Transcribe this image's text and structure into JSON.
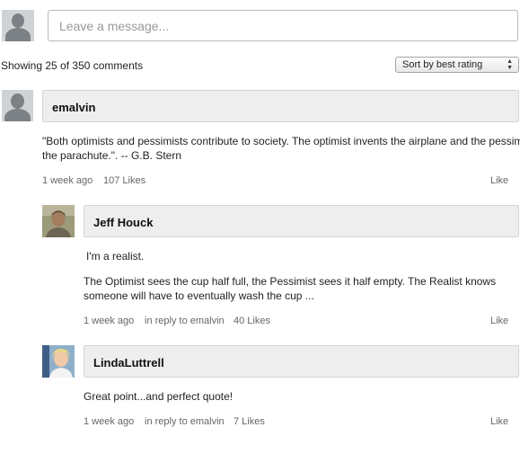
{
  "composer": {
    "placeholder": "Leave a message..."
  },
  "summary": {
    "showing_text": "Showing 25 of 350 comments",
    "sort_label": "Sort by best rating"
  },
  "comments": [
    {
      "author": "emalvin",
      "text": "\"Both optimists and pessimists contribute to society. The optimist invents the airplane and the pessimist invents",
      "text_line2": "the parachute.\". -- G.B. Stern",
      "time": "1 week ago",
      "likes": "107 Likes",
      "like_label": "Like"
    },
    {
      "author": "Jeff Houck",
      "paragraph1": "I'm a realist.",
      "paragraph2_line1": "The Optimist sees the cup half full, the Pessimist sees it half empty. The Realist knows",
      "paragraph2_line2": "someone will have to eventually wash the cup ...",
      "time": "1 week ago",
      "reply_to": "in reply to emalvin",
      "likes": "40 Likes",
      "like_label": "Like"
    },
    {
      "author": "LindaLuttrell",
      "text": "Great point...and perfect quote!",
      "time": "1 week ago",
      "reply_to": "in reply to emalvin",
      "likes": "7 Likes",
      "like_label": "Like"
    }
  ]
}
